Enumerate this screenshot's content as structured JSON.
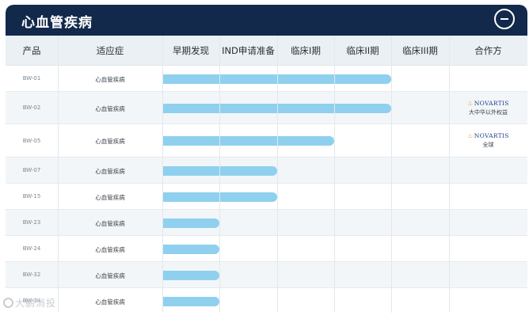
{
  "header": {
    "title": "心血管疾病"
  },
  "columns": [
    "产品",
    "适应症",
    "早期发现",
    "IND申请准备",
    "临床I期",
    "临床II期",
    "临床III期",
    "合作方"
  ],
  "rows": [
    {
      "code": "BW-01",
      "indication": "心血管疾病",
      "progress_stages": 4,
      "partner": null
    },
    {
      "code": "BW-02",
      "indication": "心血管疾病",
      "progress_stages": 4,
      "partner": {
        "logo": "NOVARTIS",
        "region": "大中华以外权益"
      }
    },
    {
      "code": "BW-05",
      "indication": "心血管疾病",
      "progress_stages": 3,
      "partner": {
        "logo": "NOVARTIS",
        "region": "全球"
      }
    },
    {
      "code": "BW-07",
      "indication": "心血管疾病",
      "progress_stages": 2,
      "partner": null
    },
    {
      "code": "BW-15",
      "indication": "心血管疾病",
      "progress_stages": 2,
      "partner": null
    },
    {
      "code": "BW-23",
      "indication": "心血管疾病",
      "progress_stages": 1,
      "partner": null
    },
    {
      "code": "BW-24",
      "indication": "心血管疾病",
      "progress_stages": 1,
      "partner": null
    },
    {
      "code": "BW-32",
      "indication": "心血管疾病",
      "progress_stages": 1,
      "partner": null
    },
    {
      "code": "BW-34",
      "indication": "心血管疾病",
      "progress_stages": 1,
      "partner": null
    }
  ],
  "watermark": {
    "text": "大鹏消投"
  },
  "colors": {
    "header_bg": "#13294b",
    "bar": "#8fd0ef",
    "partner_logo": "#1f3f8f",
    "partner_flame": "#e8871e"
  }
}
